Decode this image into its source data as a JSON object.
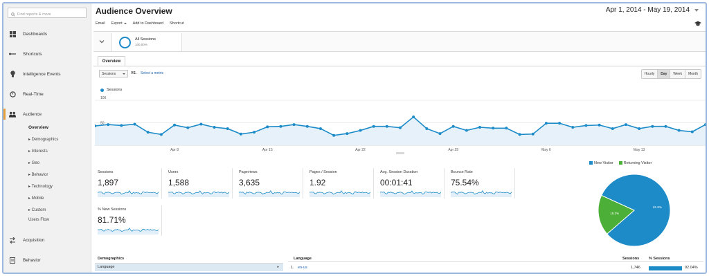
{
  "sidebar": {
    "search_placeholder": "Find reports & more",
    "items": [
      {
        "label": "Dashboards",
        "icon": "dashboard-icon"
      },
      {
        "label": "Shortcuts",
        "icon": "shortcut-icon"
      },
      {
        "label": "Intelligence Events",
        "icon": "bulb-icon"
      },
      {
        "label": "Real-Time",
        "icon": "clock-icon"
      },
      {
        "label": "Audience",
        "icon": "people-icon"
      },
      {
        "label": "Acquisition",
        "icon": "arrows-icon"
      },
      {
        "label": "Behavior",
        "icon": "document-icon"
      }
    ],
    "audience_sub": [
      "Overview",
      "▸ Demographics",
      "▸ Interests",
      "▸ Geo",
      "▸ Behavior",
      "▸ Technology",
      "▸ Mobile",
      "▸ Custom",
      "Users Flow"
    ]
  },
  "header": {
    "title": "Audience Overview",
    "date_range": "Apr 1, 2014 - May 19, 2014"
  },
  "toolbar": {
    "email": "Email",
    "export": "Export",
    "add_dashboard": "Add to Dashboard",
    "shortcut": "Shortcut"
  },
  "segment": {
    "name": "All Sessions",
    "pct": "100.00%"
  },
  "tabs": {
    "overview": "Overview"
  },
  "controls": {
    "metric": "Sessions",
    "vs": "VS.",
    "select_metric": "Select a metric",
    "granularity": [
      "Hourly",
      "Day",
      "Week",
      "Month"
    ],
    "active_granularity": "Day"
  },
  "chart_data": {
    "type": "area",
    "series": [
      {
        "name": "Sessions",
        "values": [
          43,
          46,
          44,
          47,
          29,
          24,
          45,
          39,
          47,
          40,
          37,
          25,
          29,
          41,
          42,
          46,
          42,
          37,
          22,
          26,
          33,
          42,
          42,
          39,
          63,
          37,
          26,
          42,
          33,
          40,
          38,
          38,
          24,
          25,
          49,
          49,
          40,
          44,
          45,
          37,
          46,
          37,
          42,
          42,
          33,
          30,
          46
        ]
      }
    ],
    "ylim": [
      0,
      100
    ],
    "y_ticks": [
      "100",
      "50"
    ],
    "x_tick_labels": [
      "Apr 8",
      "Apr 15",
      "Apr 22",
      "Apr 29",
      "May 6",
      "May 13"
    ],
    "color": "#1c8bc8"
  },
  "scorecards": [
    {
      "label": "Sessions",
      "value": "1,897"
    },
    {
      "label": "Users",
      "value": "1,588"
    },
    {
      "label": "Pageviews",
      "value": "3,635"
    },
    {
      "label": "Pages / Session",
      "value": "1.92"
    },
    {
      "label": "Avg. Session Duration",
      "value": "00:01:41"
    },
    {
      "label": "Bounce Rate",
      "value": "75.54%"
    },
    {
      "label": "% New Sessions",
      "value": "81.71%"
    }
  ],
  "pie": {
    "legend": [
      "New Visitor",
      "Returning Visitor"
    ],
    "colors": [
      "#1c8bc8",
      "#4caf38"
    ],
    "values": [
      81.8,
      18.2
    ],
    "labels": [
      "81.8%",
      "18.2%"
    ]
  },
  "bottom": {
    "demographics_title": "Demographics",
    "demographics_item": "Language",
    "lang_title": "Language",
    "sessions_col": "Sessions",
    "pct_col": "% Sessions",
    "row": {
      "index": "1.",
      "name": "en-us",
      "sessions": "1,746",
      "pct": "92.04%"
    }
  }
}
